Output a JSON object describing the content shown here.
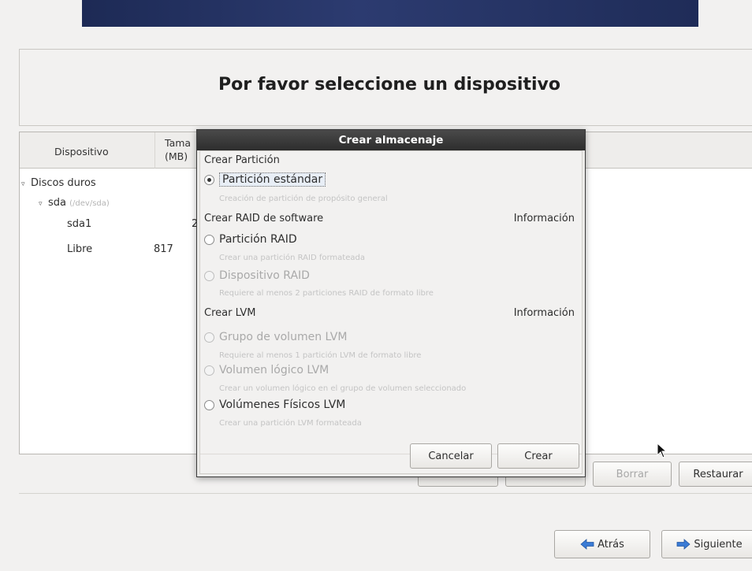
{
  "page": {
    "title": "Por favor seleccione un dispositivo"
  },
  "device_table": {
    "col_device": "Dispositivo",
    "col_size_line1": "Tama",
    "col_size_line2": "(MB)",
    "rows": [
      {
        "name": "Discos duros",
        "expanded": true
      },
      {
        "name": "sda",
        "sub": "(/dev/sda)",
        "expanded": true
      },
      {
        "name": "sda1",
        "size": "2"
      },
      {
        "name": "Libre",
        "size": "817"
      }
    ]
  },
  "bottom_buttons": {
    "delete": "Borrar",
    "reset": "Restaurar",
    "back": "Atrás",
    "next": "Siguiente"
  },
  "dialog": {
    "title": "Crear almacenaje",
    "section_partition": "Crear Partición",
    "opt_standard": "Partición estándar",
    "desc_standard": "Creación de partición de propósito general",
    "section_raid": "Crear RAID de software",
    "info_raid": "Información",
    "opt_raid_partition": "Partición RAID",
    "desc_raid_partition": "Crear una partición RAID formateada",
    "opt_raid_device": "Dispositivo RAID",
    "desc_raid_device": "Requiere al menos 2 particiones RAID de formato libre",
    "section_lvm": "Crear LVM",
    "info_lvm": "Información",
    "opt_lvm_group": "Grupo de volumen LVM",
    "desc_lvm_group": "Requiere al menos 1 partición LVM de formato libre",
    "opt_lvm_logical": "Volumen lógico LVM",
    "desc_lvm_logical": "Crear un volumen lógico en el grupo de volumen seleccionado",
    "opt_lvm_physical": "Volúmenes Físicos LVM",
    "desc_lvm_physical": "Crear una partición LVM formateada",
    "cancel": "Cancelar",
    "create": "Crear",
    "selected_option": "Partición estándar"
  },
  "colors": {
    "banner": "#1d2a55",
    "dialog_title_bg": "#2d2d2d",
    "arrow_icon": "#3a7bd5"
  },
  "icons": {
    "back": "arrow-left-icon",
    "next": "arrow-right-icon",
    "expand": "triangle-down-icon",
    "cursor": "mouse-pointer-icon"
  }
}
